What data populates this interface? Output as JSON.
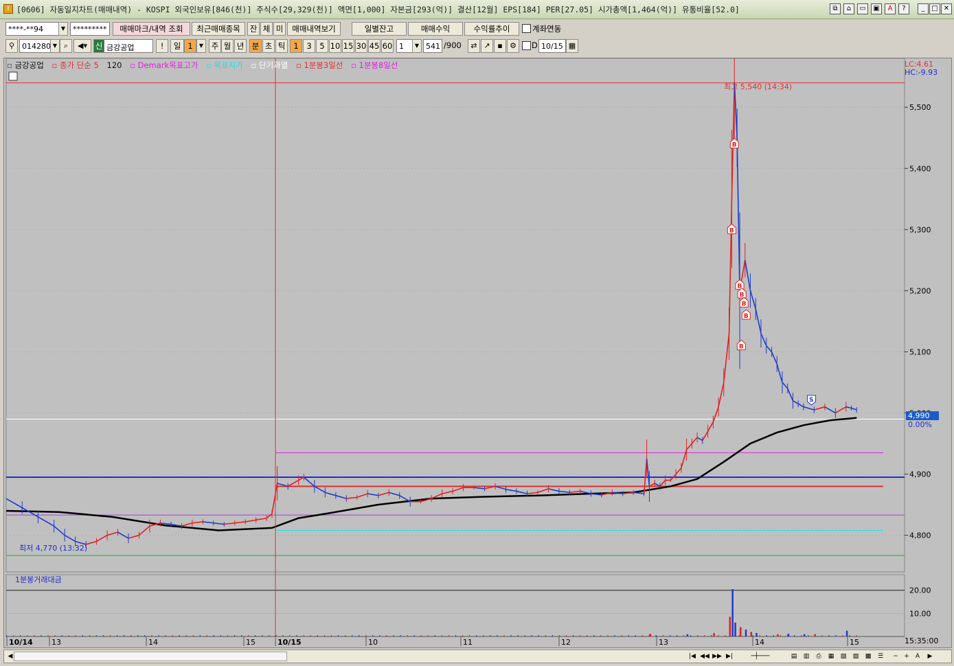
{
  "window": {
    "title": "[0606] 자동일지차트(매매내역) - KOSPI 외국인보유[846(천)] 주식수[29,329(천)] 액면[1,000] 자본금[293(억)] 결산[12월] EPS[184] PER[27.05] 시가총액[1,464(억)] 유통비율[52.0]",
    "app_icon": "I"
  },
  "toolbar1": {
    "account": "****-**94",
    "password": "*********",
    "trade_mark_button": "매매마크/내역 조회",
    "recent_items_button": "최근매매종목",
    "jan_button": "잔",
    "che_button": "체",
    "mi_button": "미",
    "trade_history_button": "매매내역보기",
    "daily_balance_button": "일별잔고",
    "trade_profit_button": "매매수익",
    "return_trend_button": "수익률추이",
    "account_link_label": "계좌연동"
  },
  "toolbar2": {
    "stock_code": "014280",
    "new_badge": "신",
    "stock_name": "금강공업",
    "excl": "!",
    "period_label": "일",
    "period_value": "1",
    "week": "주",
    "month": "월",
    "year": "년",
    "minute": "분",
    "second": "초",
    "tick": "틱",
    "intervals": [
      "1",
      "3",
      "5",
      "10",
      "15",
      "30",
      "45",
      "60"
    ],
    "interval_value": "1",
    "count_value": "541",
    "count_total": "/900",
    "d_label": "D",
    "date_value": "10/15"
  },
  "legend": {
    "stock": "금강공업",
    "close_ma": "종가 단순 5",
    "ma_period": "120",
    "demark_high": "Demark목표고가",
    "target_price": "목표지가",
    "short_overheat": "단기과열",
    "line3": "1분봉3일선",
    "line8": "1분봉8일선",
    "lc": "LC:4.61",
    "hc": "HC:-9.93"
  },
  "chart_data": {
    "type": "line",
    "title": "",
    "ylim": [
      4740,
      5580
    ],
    "y_ticks": [
      "5,500",
      "5,400",
      "5,300",
      "5,200",
      "5,100",
      "5,000",
      "4,900",
      "4,800"
    ],
    "x_labels": [
      "10/14",
      "13",
      "14",
      "15",
      "10/15",
      "10",
      "11",
      "12",
      "13",
      "14",
      "15"
    ],
    "time_axis_end": "15:35:00",
    "current_price": "4,990",
    "current_change": "0.00%",
    "high_annotation": "최고 5,540 (14:34)",
    "low_annotation": "최저 4,770 (13:32)",
    "horizontal_lines": [
      {
        "name": "high-line",
        "value": 5540,
        "color": "#e03030"
      },
      {
        "name": "demark-high-line",
        "value": 4935,
        "color": "#e020e0"
      },
      {
        "name": "blue-line",
        "value": 4895,
        "color": "#1c2ccc"
      },
      {
        "name": "red-line",
        "value": 4880,
        "color": "#e03030"
      },
      {
        "name": "violet-line",
        "value": 4833,
        "color": "#a040e0"
      },
      {
        "name": "cyan-line",
        "value": 4808,
        "color": "#20e0e0"
      },
      {
        "name": "green-line",
        "value": 4767,
        "color": "#20b020"
      },
      {
        "name": "current-line",
        "value": 4990,
        "color": "#ffffff"
      }
    ],
    "price_path": [
      [
        0,
        4860
      ],
      [
        3,
        4845
      ],
      [
        6,
        4830
      ],
      [
        9,
        4815
      ],
      [
        11,
        4800
      ],
      [
        13,
        4790
      ],
      [
        15,
        4785
      ],
      [
        17,
        4790
      ],
      [
        19,
        4800
      ],
      [
        21,
        4805
      ],
      [
        23,
        4795
      ],
      [
        25,
        4800
      ],
      [
        27,
        4815
      ],
      [
        29,
        4820
      ],
      [
        31,
        4818
      ],
      [
        33,
        4815
      ],
      [
        35,
        4820
      ],
      [
        37,
        4822
      ],
      [
        39,
        4820
      ],
      [
        41,
        4818
      ],
      [
        43,
        4820
      ],
      [
        45,
        4822
      ],
      [
        47,
        4825
      ],
      [
        49,
        4828
      ],
      [
        50,
        4835
      ],
      [
        51,
        4885
      ],
      [
        53,
        4880
      ],
      [
        55,
        4890
      ],
      [
        56,
        4895
      ],
      [
        58,
        4880
      ],
      [
        60,
        4870
      ],
      [
        62,
        4865
      ],
      [
        64,
        4860
      ],
      [
        66,
        4862
      ],
      [
        68,
        4868
      ],
      [
        70,
        4865
      ],
      [
        72,
        4870
      ],
      [
        74,
        4865
      ],
      [
        76,
        4855
      ],
      [
        78,
        4855
      ],
      [
        80,
        4860
      ],
      [
        82,
        4868
      ],
      [
        84,
        4872
      ],
      [
        86,
        4878
      ],
      [
        88,
        4878
      ],
      [
        90,
        4876
      ],
      [
        92,
        4880
      ],
      [
        94,
        4875
      ],
      [
        96,
        4872
      ],
      [
        98,
        4868
      ],
      [
        100,
        4870
      ],
      [
        102,
        4876
      ],
      [
        104,
        4872
      ],
      [
        106,
        4870
      ],
      [
        108,
        4872
      ],
      [
        110,
        4868
      ],
      [
        112,
        4866
      ],
      [
        114,
        4870
      ],
      [
        116,
        4868
      ],
      [
        118,
        4870
      ],
      [
        120,
        4868
      ],
      [
        120.5,
        4925
      ],
      [
        121,
        4880
      ],
      [
        122,
        4885
      ],
      [
        123,
        4880
      ],
      [
        124,
        4890
      ],
      [
        125,
        4890
      ],
      [
        126,
        4900
      ],
      [
        127,
        4910
      ],
      [
        128,
        4940
      ],
      [
        129,
        4950
      ],
      [
        130,
        4960
      ],
      [
        131,
        4955
      ],
      [
        132,
        4970
      ],
      [
        133,
        4985
      ],
      [
        134,
        5010
      ],
      [
        135,
        5050
      ],
      [
        136,
        5130
      ],
      [
        136.5,
        5350
      ],
      [
        137,
        5540
      ],
      [
        137.5,
        5450
      ],
      [
        138,
        5200
      ],
      [
        139,
        5250
      ],
      [
        140,
        5200
      ],
      [
        141,
        5170
      ],
      [
        142,
        5130
      ],
      [
        143,
        5110
      ],
      [
        144,
        5100
      ],
      [
        145,
        5080
      ],
      [
        146,
        5050
      ],
      [
        147,
        5040
      ],
      [
        148,
        5020
      ],
      [
        149,
        5015
      ],
      [
        150,
        5010
      ],
      [
        152,
        5005
      ],
      [
        154,
        5010
      ],
      [
        156,
        5000
      ],
      [
        158,
        5010
      ],
      [
        159,
        5008
      ],
      [
        160,
        5005
      ]
    ],
    "moving_average_path": [
      [
        0,
        4840
      ],
      [
        10,
        4838
      ],
      [
        20,
        4830
      ],
      [
        30,
        4816
      ],
      [
        40,
        4808
      ],
      [
        50,
        4812
      ],
      [
        55,
        4828
      ],
      [
        60,
        4835
      ],
      [
        70,
        4850
      ],
      [
        80,
        4860
      ],
      [
        90,
        4863
      ],
      [
        100,
        4865
      ],
      [
        110,
        4868
      ],
      [
        118,
        4870
      ],
      [
        125,
        4880
      ],
      [
        130,
        4892
      ],
      [
        135,
        4920
      ],
      [
        140,
        4950
      ],
      [
        145,
        4968
      ],
      [
        150,
        4980
      ],
      [
        155,
        4988
      ],
      [
        160,
        4992
      ]
    ],
    "buy_marks": [
      5440,
      5300,
      5209,
      5195,
      5180,
      5160,
      5110
    ],
    "sell_marks": [
      5022
    ],
    "volume_panel": {
      "title": "1분봉거래대금",
      "y_ticks": [
        "20.00",
        "10.00"
      ],
      "ylim": [
        0,
        22
      ],
      "bars": [
        [
          136.5,
          20.5
        ],
        [
          136,
          8.5
        ],
        [
          137,
          6
        ],
        [
          138,
          4
        ],
        [
          139,
          3
        ],
        [
          140,
          2
        ],
        [
          141,
          1.5
        ],
        [
          133,
          1.5
        ],
        [
          128,
          1
        ],
        [
          121,
          1.2
        ],
        [
          150,
          1
        ],
        [
          152,
          1
        ],
        [
          158,
          2.5
        ],
        [
          145,
          1
        ],
        [
          147,
          1.2
        ]
      ]
    },
    "x_domain": [
      0,
      165
    ]
  }
}
